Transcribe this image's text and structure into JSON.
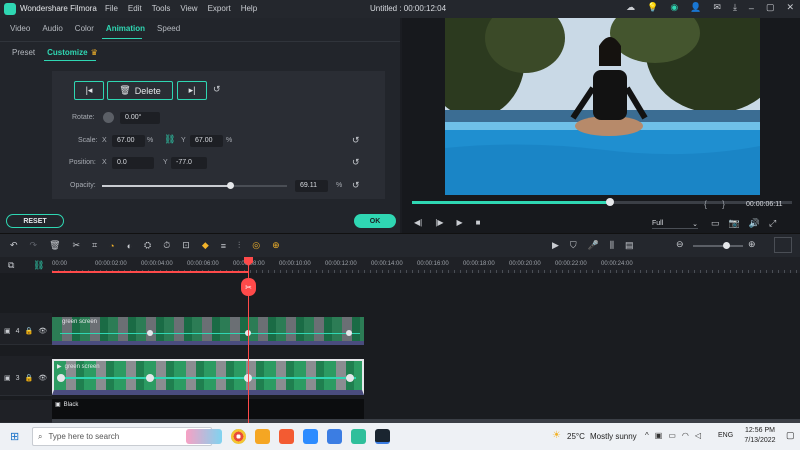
{
  "titlebar": {
    "app_name": "Wondershare Filmora",
    "menu": [
      "File",
      "Edit",
      "Tools",
      "View",
      "Export",
      "Help"
    ],
    "title": "Untitled : 00:00:12:04"
  },
  "panel": {
    "tabs": [
      "Video",
      "Audio",
      "Color",
      "Animation",
      "Speed"
    ],
    "subtabs": [
      "Preset",
      "Customize"
    ],
    "delete_label": "Delete",
    "rotate_label": "Rotate:",
    "rotate_value": "0.00°",
    "scale_label": "Scale:",
    "scale_x_label": "X",
    "scale_x": "67.00",
    "scale_y_label": "Y",
    "scale_y": "67.00",
    "percent": "%",
    "position_label": "Position:",
    "pos_x_label": "X",
    "pos_x": "0.0",
    "pos_y_label": "Y",
    "pos_y": "-77.0",
    "opacity_label": "Opacity:",
    "opacity_value": "69.11",
    "opacity_fraction": 0.69,
    "reset_label": "RESET",
    "ok_label": "OK"
  },
  "player": {
    "bracket_left": "{",
    "bracket_right": "}",
    "time": "00:00:06:11",
    "quality": "Full",
    "progress_fraction": 0.52
  },
  "ruler": {
    "labels": [
      "00:00",
      "00:00:02:00",
      "00:00:04:00",
      "00:00:06:00",
      "00:00:08:00",
      "00:00:10:00",
      "00:00:12:00",
      "00:00:14:00",
      "00:00:16:00",
      "00:00:18:00",
      "00:00:20:00",
      "00:00:22:00",
      "00:00:24:00"
    ]
  },
  "tracks": {
    "track4_num": "4",
    "track3_num": "3",
    "clip1_name": "green screen",
    "clip2_name": "green screen",
    "clip3_name": "Black"
  },
  "taskbar": {
    "search_placeholder": "Type here to search",
    "temperature": "25°C",
    "weather": "Mostly sunny",
    "lang": "ENG",
    "time": "12:56 PM",
    "date": "7/13/2022"
  },
  "colors": {
    "accent": "#2fd7b3",
    "playhead": "#ff4a4a"
  }
}
